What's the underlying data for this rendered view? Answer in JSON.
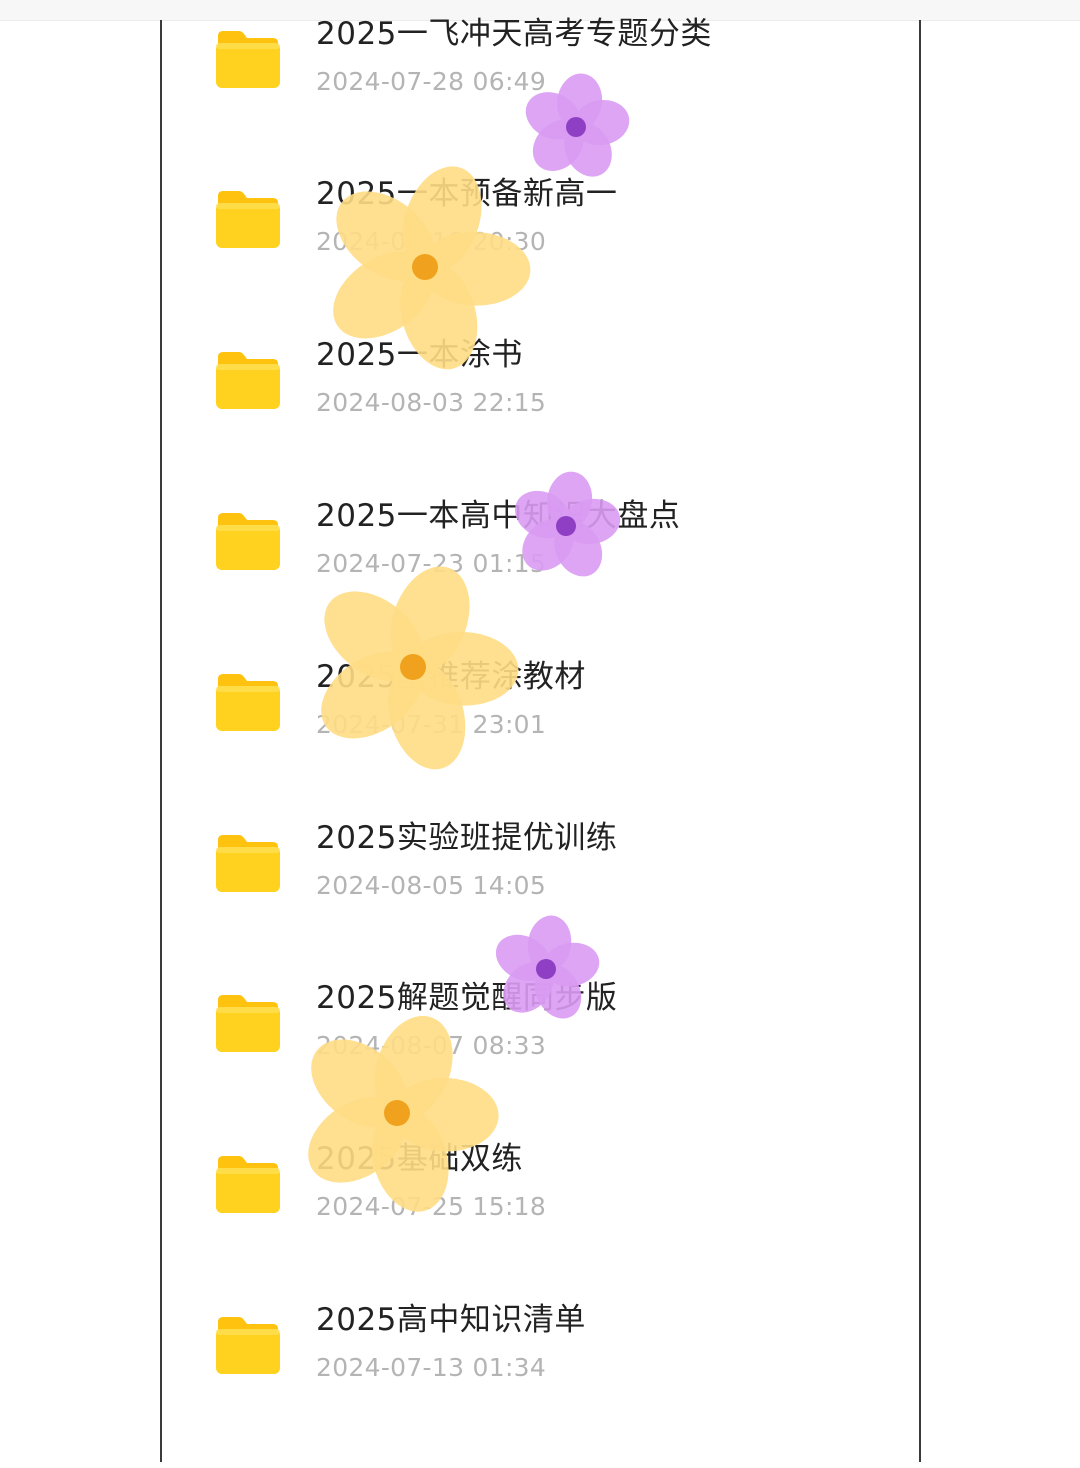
{
  "colors": {
    "folder_primary": "#FFD21F",
    "folder_tab": "#FFC20E",
    "name_text": "#222222",
    "date_text": "#B4B4B4",
    "sticker_yellow": "#FFDD85",
    "sticker_yellow_center": "#F0A21E",
    "sticker_purple": "#D99BF2",
    "sticker_purple_center": "#8E3FC4"
  },
  "icons": {
    "folder": "folder-icon",
    "yellow_sticker": "yellow-flower-sticker",
    "purple_sticker": "purple-flower-sticker"
  },
  "files": [
    {
      "name": "2025一飞冲天高考专题分类",
      "date": "2024-07-28 06:49"
    },
    {
      "name": "2025一本预备新高一",
      "date": "2024-07-18 20:30"
    },
    {
      "name": "2025一本涂书",
      "date": "2024-08-03 22:15"
    },
    {
      "name": "2025一本高中知识大盘点",
      "date": "2024-07-23 01:15"
    },
    {
      "name": "2025星推荐涂教材",
      "date": "2024-07-31 23:01"
    },
    {
      "name": "2025实验班提优训练",
      "date": "2024-08-05 14:05"
    },
    {
      "name": "2025解题觉醒同步版",
      "date": "2024-08-07 08:33"
    },
    {
      "name": "2025基础双练",
      "date": "2024-07-25 15:18"
    },
    {
      "name": "2025高中知识清单",
      "date": "2024-07-13 01:34"
    }
  ]
}
